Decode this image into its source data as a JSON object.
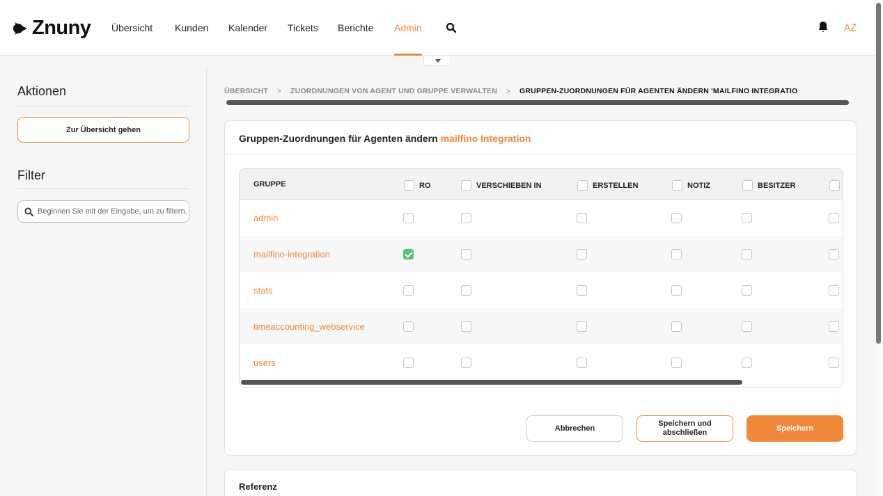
{
  "app": {
    "logo_text": "Znuny"
  },
  "nav": {
    "items": [
      "Übersicht",
      "Kunden",
      "Kalender",
      "Tickets",
      "Berichte",
      "Admin"
    ],
    "active": "Admin",
    "search_icon": "search-icon",
    "bell_icon": "bell-icon"
  },
  "user": {
    "initials": "AZ"
  },
  "sidebar": {
    "actions_heading": "Aktionen",
    "overview_button": "Zur Übersicht gehen",
    "filter_heading": "Filter",
    "filter_placeholder": "Beginnen Sie mit der Eingabe, um zu filtern..."
  },
  "breadcrumb": [
    "ÜBERSICHT",
    "ZUORDNUNGEN VON AGENT UND GRUPPE VERWALTEN",
    "GRUPPEN-ZUORDNUNGEN FÜR AGENTEN ÄNDERN 'MAILFINO INTEGRATIO"
  ],
  "card": {
    "title_prefix": "Gruppen-Zuordnungen für Agenten ändern",
    "title_highlight": "mailfino Integration"
  },
  "table": {
    "columns": [
      "GRUPPE",
      "RO",
      "VERSCHIEBEN IN",
      "ERSTELLEN",
      "NOTIZ",
      "BESITZER",
      ""
    ],
    "rows": [
      {
        "name": "admin",
        "checks": [
          false,
          false,
          false,
          false,
          false,
          false
        ]
      },
      {
        "name": "mailfino-integration",
        "checks": [
          true,
          false,
          false,
          false,
          false,
          false
        ]
      },
      {
        "name": "stats",
        "checks": [
          false,
          false,
          false,
          false,
          false,
          false
        ]
      },
      {
        "name": "timeaccounting_webservice",
        "checks": [
          false,
          false,
          false,
          false,
          false,
          false
        ]
      },
      {
        "name": "users",
        "checks": [
          false,
          false,
          false,
          false,
          false,
          false
        ]
      }
    ]
  },
  "buttons": {
    "cancel": "Abbrechen",
    "save_close": "Speichern und abschließen",
    "save": "Speichern"
  },
  "reference": {
    "title": "Referenz"
  },
  "colors": {
    "accent": "#f0883a",
    "checked": "#50c878"
  }
}
